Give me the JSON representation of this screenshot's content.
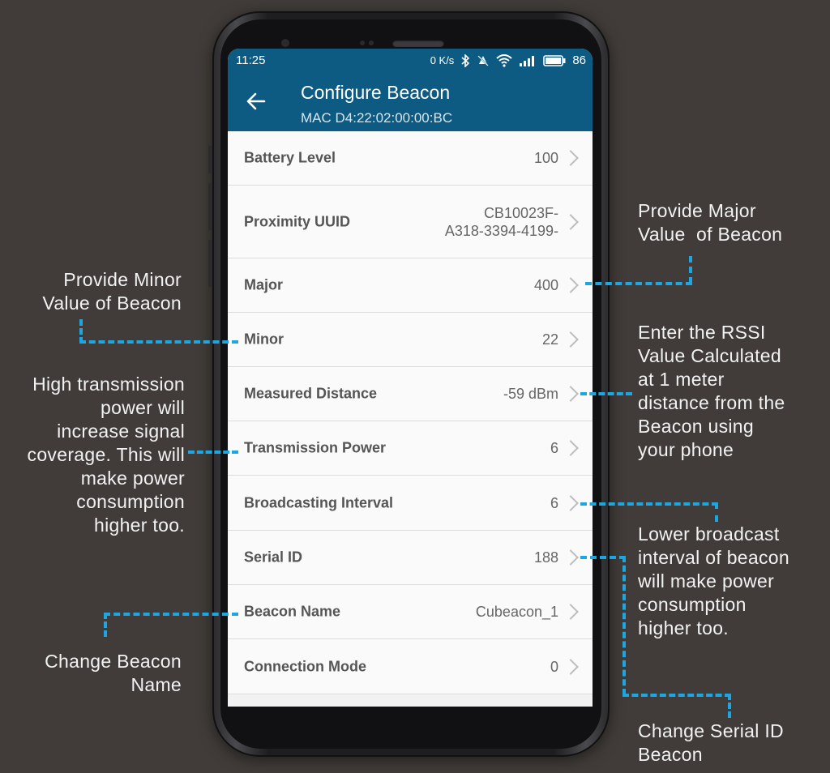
{
  "status_bar": {
    "time": "11:25",
    "data_speed": "0 K/s",
    "battery_percent": "86",
    "icons": [
      "bluetooth-icon",
      "mute-icon",
      "wifi-icon",
      "signal-icon",
      "battery-icon"
    ]
  },
  "app_bar": {
    "title": "Configure Beacon",
    "subtitle": "MAC D4:22:02:00:00:BC",
    "back_icon": "arrow-left-icon"
  },
  "settings": [
    {
      "label": "Battery Level",
      "value": "100"
    },
    {
      "label": "Proximity UUID",
      "value_lines": [
        "CB10023F-",
        "A318-3394-4199-"
      ]
    },
    {
      "label": "Major",
      "value": "400"
    },
    {
      "label": "Minor",
      "value": "22"
    },
    {
      "label": "Measured Distance",
      "value": "-59 dBm"
    },
    {
      "label": "Transmission Power",
      "value": "6"
    },
    {
      "label": "Broadcasting Interval",
      "value": "6"
    },
    {
      "label": "Serial ID",
      "value": "188"
    },
    {
      "label": "Beacon Name",
      "value": "Cubeacon_1"
    },
    {
      "label": "Connection Mode",
      "value": "0"
    }
  ],
  "annotations": {
    "major": [
      "Provide Major",
      "Value  of Beacon"
    ],
    "minor": [
      "Provide Minor",
      "Value of Beacon"
    ],
    "rssi": [
      "Enter the RSSI",
      "Value Calculated",
      "at 1 meter",
      "distance from the",
      "Beacon using",
      "your phone"
    ],
    "tx_power": [
      "High transmission",
      "power will",
      "increase signal",
      "coverage. This will",
      "make power",
      "consumption",
      "higher too."
    ],
    "interval": [
      "Lower broadcast",
      "interval of beacon",
      "will make power",
      "consumption",
      "higher too."
    ],
    "beacon_name": [
      "Change Beacon",
      "Name"
    ],
    "serial_id": [
      "Change Serial ID",
      "Beacon"
    ]
  },
  "colors": {
    "app_bar": "#0d5a82",
    "background": "#413c39",
    "annotation_line": "#1ea6e0"
  }
}
